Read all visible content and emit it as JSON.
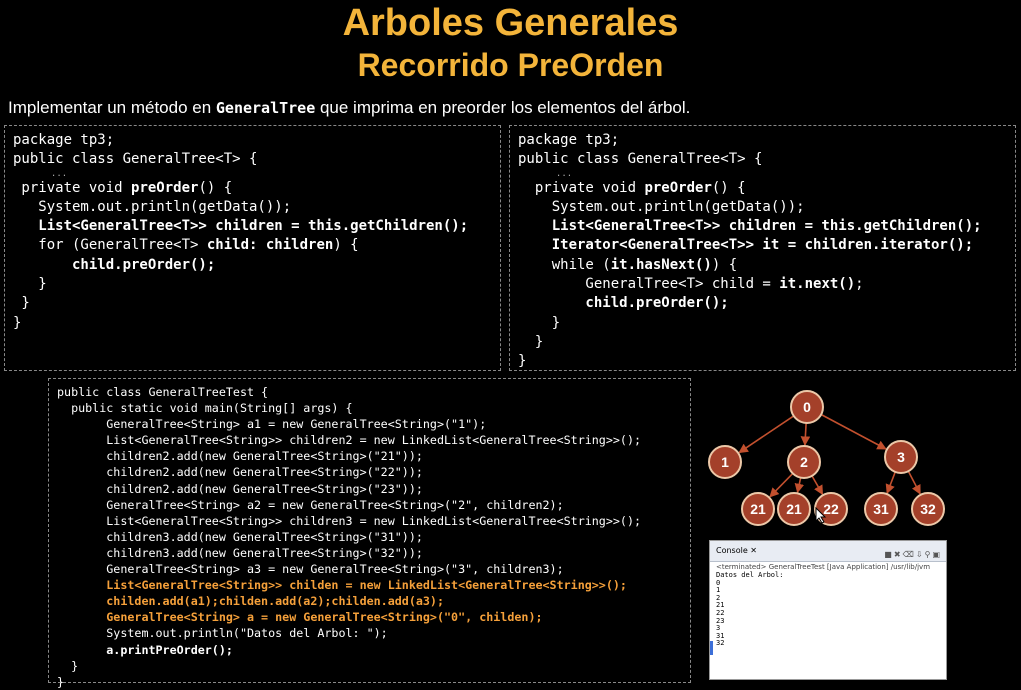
{
  "title": "Arboles Generales",
  "subtitle": "Recorrido PreOrden",
  "intro": {
    "before": "Implementar un método en ",
    "code": "GeneralTree",
    "after": " que imprima en preorder los elementos del árbol."
  },
  "code_left": [
    {
      "text": "package tp3;",
      "bold": false
    },
    {
      "text": "public class GeneralTree<T> {",
      "bold": false
    },
    {
      "text": "...",
      "dots": true
    },
    {
      "text": " private void preOrder() {",
      "mixed": [
        " private void ",
        "preOrder",
        "() {"
      ]
    },
    {
      "text": "   System.out.println(getData());",
      "bold": false
    },
    {
      "text": "   List<GeneralTree<T>> children = this.getChildren();",
      "bold": true
    },
    {
      "text": "   for (GeneralTree<T> child: children) {",
      "mixed": [
        "   for (GeneralTree<T> ",
        "child: children",
        ") {"
      ]
    },
    {
      "text": "       child.preOrder();",
      "bold": true
    },
    {
      "text": "   }",
      "bold": false
    },
    {
      "text": " }",
      "bold": false
    },
    {
      "text": "}",
      "bold": false
    }
  ],
  "code_right": [
    {
      "text": "package tp3;",
      "bold": false
    },
    {
      "text": "public class GeneralTree<T> {",
      "bold": false
    },
    {
      "text": "...",
      "dots": true
    },
    {
      "text": "  private void preOrder() {",
      "mixed": [
        "  private void ",
        "preOrder",
        "() {"
      ]
    },
    {
      "text": "    System.out.println(getData());",
      "bold": false
    },
    {
      "text": "    List<GeneralTree<T>> children = this.getChildren();",
      "bold": true
    },
    {
      "text": "    Iterator<GeneralTree<T>> it = children.iterator();",
      "bold": true
    },
    {
      "text": "    while (it.hasNext()) {",
      "mixed": [
        "    while (",
        "it.hasNext()",
        ") {"
      ]
    },
    {
      "text": "        GeneralTree<T> child = it.next();",
      "mixed": [
        "        GeneralTree<T> child = ",
        "it.next()",
        ";"
      ]
    },
    {
      "text": "        child.preOrder();",
      "bold": true
    },
    {
      "text": "    }",
      "bold": false
    },
    {
      "text": "  }",
      "bold": false
    },
    {
      "text": "}",
      "bold": false
    }
  ],
  "code_test": [
    {
      "text": "public class GeneralTreeTest {",
      "style": "plain"
    },
    {
      "text": "  public static void main(String[] args) {",
      "style": "plain"
    },
    {
      "text": "       GeneralTree<String> a1 = new GeneralTree<String>(\"1\");",
      "style": "plain"
    },
    {
      "text": "       List<GeneralTree<String>> children2 = new LinkedList<GeneralTree<String>>();",
      "style": "plain"
    },
    {
      "text": "       children2.add(new GeneralTree<String>(\"21\"));",
      "style": "plain"
    },
    {
      "text": "       children2.add(new GeneralTree<String>(\"22\"));",
      "style": "plain"
    },
    {
      "text": "       children2.add(new GeneralTree<String>(\"23\"));",
      "style": "plain"
    },
    {
      "text": "       GeneralTree<String> a2 = new GeneralTree<String>(\"2\", children2);",
      "style": "plain"
    },
    {
      "text": "       List<GeneralTree<String>> children3 = new LinkedList<GeneralTree<String>>();",
      "style": "plain"
    },
    {
      "text": "       children3.add(new GeneralTree<String>(\"31\"));",
      "style": "plain"
    },
    {
      "text": "       children3.add(new GeneralTree<String>(\"32\"));",
      "style": "plain"
    },
    {
      "text": "       GeneralTree<String> a3 = new GeneralTree<String>(\"3\", children3);",
      "style": "plain"
    },
    {
      "text": "       List<GeneralTree<String>> childen = new LinkedList<GeneralTree<String>>();",
      "style": "orange"
    },
    {
      "text": "       childen.add(a1);childen.add(a2);childen.add(a3);",
      "style": "orange"
    },
    {
      "text": "       GeneralTree<String> a = new GeneralTree<String>(\"0\", childen);",
      "style": "orange"
    },
    {
      "text": "       System.out.println(\"Datos del Arbol: \");",
      "style": "plain"
    },
    {
      "text": "       a.printPreOrder();",
      "style": "bold"
    },
    {
      "text": "  }",
      "style": "plain"
    },
    {
      "text": "}",
      "style": "plain"
    }
  ],
  "tree": {
    "colors": {
      "node_fill": "#a4402a",
      "node_border": "#ecc8a8",
      "edge": "#c2502e",
      "label": "#ffffff"
    },
    "nodes": [
      {
        "id": "n0",
        "label": "0"
      },
      {
        "id": "n1",
        "label": "1"
      },
      {
        "id": "n2",
        "label": "2"
      },
      {
        "id": "n3",
        "label": "3"
      },
      {
        "id": "n21",
        "label": "21"
      },
      {
        "id": "n21b",
        "label": "21"
      },
      {
        "id": "n22",
        "label": "22"
      },
      {
        "id": "n31",
        "label": "31"
      },
      {
        "id": "n32",
        "label": "32"
      }
    ],
    "edges": [
      [
        "n0",
        "n1"
      ],
      [
        "n0",
        "n2"
      ],
      [
        "n0",
        "n3"
      ],
      [
        "n2",
        "n21"
      ],
      [
        "n2",
        "n21b"
      ],
      [
        "n2",
        "n22"
      ],
      [
        "n3",
        "n31"
      ],
      [
        "n3",
        "n32"
      ]
    ]
  },
  "console": {
    "tab_label": "Console ✕",
    "toolbar_icons": [
      "terminate-icon",
      "remove-icon",
      "clear-icon",
      "scroll-lock-icon",
      "pin-icon",
      "open-console-icon"
    ],
    "terminated": "<terminated> GeneralTreeTest [Java Application] /usr/lib/jvm",
    "output": [
      "Datos del Arbol:",
      "0",
      "1",
      "2",
      "21",
      "22",
      "23",
      "3",
      "31",
      "32"
    ]
  }
}
